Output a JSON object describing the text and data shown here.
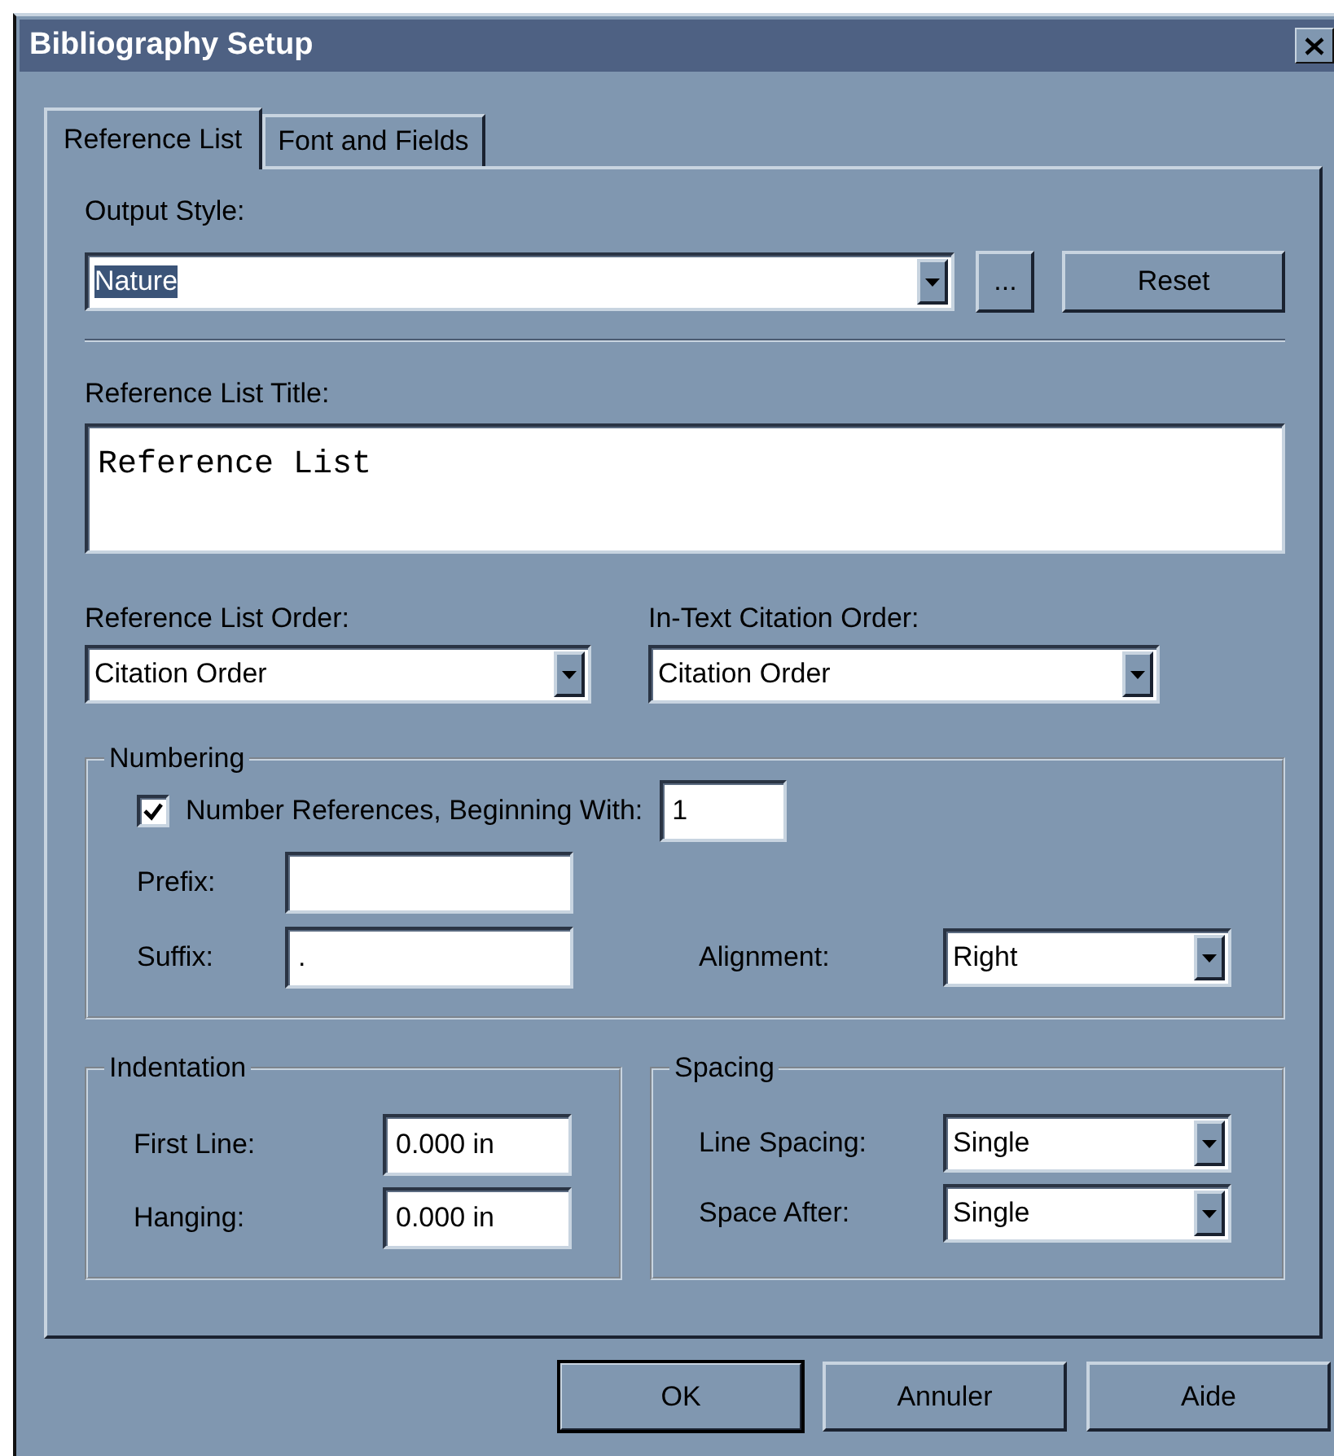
{
  "window": {
    "title": "Bibliography Setup"
  },
  "tabs": [
    {
      "label": "Reference List",
      "selected": true
    },
    {
      "label": "Font and Fields",
      "selected": false
    }
  ],
  "output_style": {
    "label": "Output Style:",
    "value": "Nature",
    "text_selected": true
  },
  "browse_button": "...",
  "reset_button": "Reset",
  "title_field": {
    "label": "Reference List Title:",
    "value": "Reference List"
  },
  "reference_list_order": {
    "label": "Reference List Order:",
    "value": "Citation Order"
  },
  "in_text_citation_order": {
    "label": "In-Text Citation Order:",
    "value": "Citation Order"
  },
  "numbering": {
    "title": "Numbering",
    "number_references": {
      "label": "Number References, Beginning With:",
      "checked": true,
      "value": "1"
    },
    "prefix": {
      "label": "Prefix:"
    },
    "suffix": {
      "label": "Suffix:",
      "value": "."
    },
    "alignment": {
      "label": "Alignment:",
      "value": "Right"
    }
  },
  "indentation": {
    "title": "Indentation",
    "fields": [
      {
        "label": "First Line:",
        "value": "0.000 in"
      },
      {
        "label": "Hanging:",
        "value": "0.000 in"
      }
    ]
  },
  "spacing": {
    "title": "Spacing",
    "fields": [
      {
        "label": "Line Spacing:",
        "value": "Single"
      },
      {
        "label": "Space After:",
        "value": "Single"
      }
    ]
  },
  "buttons": [
    {
      "label": "OK",
      "default": true
    },
    {
      "label": "Annuler",
      "default": false
    },
    {
      "label": "Aide",
      "default": false
    }
  ]
}
